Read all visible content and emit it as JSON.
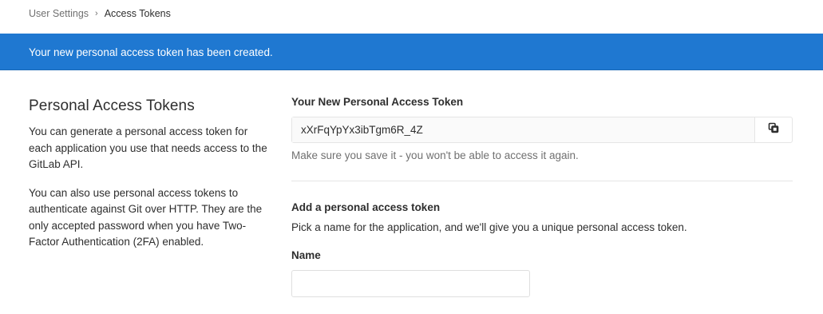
{
  "breadcrumb": {
    "parent": "User Settings",
    "separator": "›",
    "current": "Access Tokens"
  },
  "flash": {
    "message": "Your new personal access token has been created."
  },
  "left": {
    "title": "Personal Access Tokens",
    "paragraph1": "You can generate a personal access token for each application you use that needs access to the GitLab API.",
    "paragraph2": "You can also use personal access tokens to authenticate against Git over HTTP. They are the only accepted password when you have Two-Factor Authentication (2FA) enabled."
  },
  "new_token": {
    "label": "Your New Personal Access Token",
    "value": "xXrFqYpYx3ibTgm6R_4Z",
    "copy_icon": "copy-icon",
    "hint": "Make sure you save it - you won't be able to access it again."
  },
  "add_token": {
    "title": "Add a personal access token",
    "description": "Pick a name for the application, and we'll give you a unique personal access token.",
    "name_label": "Name",
    "name_value": ""
  },
  "colors": {
    "flash_bg": "#1f78d1",
    "text": "#2e2e2e",
    "muted": "#707070"
  }
}
